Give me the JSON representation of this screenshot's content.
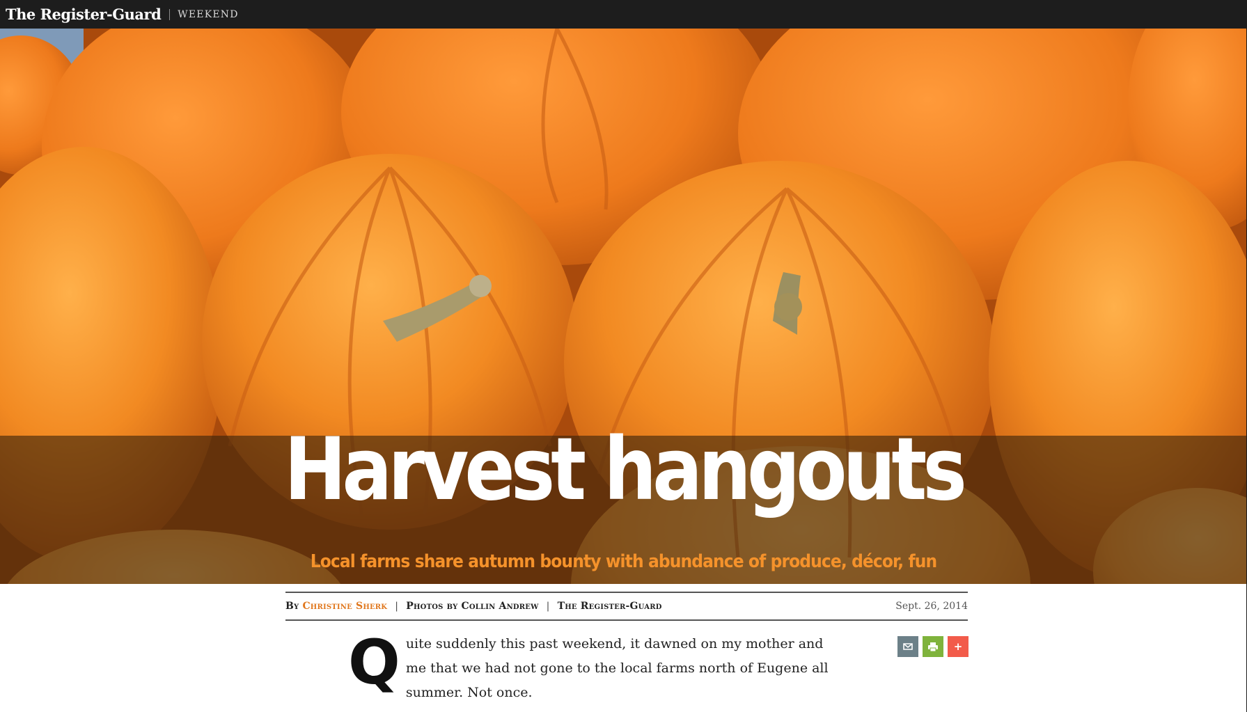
{
  "topbar": {
    "masthead": "The Register-Guard",
    "section": "WEEKEND"
  },
  "hero": {
    "headline": "Harvest hangouts",
    "dek": "Local farms share autumn bounty with abundance of produce, décor, fun",
    "image_subject": "pumpkins"
  },
  "byline": {
    "prefix": "By",
    "author": "Christine Sherk",
    "photos": "Photos by Collin Andrew",
    "publication": "The Register-Guard",
    "date": "Sept. 26, 2014"
  },
  "article": {
    "dropcap": "Q",
    "lead": "uite suddenly this past weekend, it dawned on my mother and me that we had not gone to the local farms north of Eugene all summer. Not once."
  },
  "tools": {
    "email_icon": "email-icon",
    "print_icon": "print-icon",
    "share_icon": "plus-icon",
    "share_label": "+"
  },
  "colors": {
    "accent": "#e0771d",
    "dek": "#f5922b",
    "topbar": "#1d1d1d",
    "email": "#6c8088",
    "print": "#7fb33c",
    "share": "#f25b4a"
  }
}
